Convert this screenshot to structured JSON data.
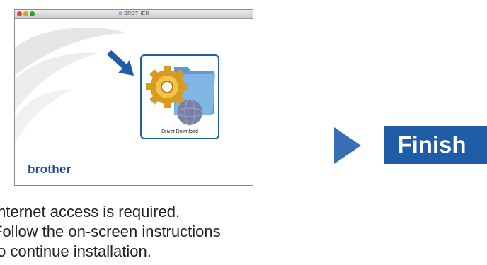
{
  "window": {
    "title": "BROTHER",
    "brand": "brother",
    "driver_button_label": "Driver Download"
  },
  "finish_label": "Finish",
  "instructions": [
    "Internet access is required.",
    "Follow the on-screen instructions",
    "to continue installation."
  ],
  "colors": {
    "brand_blue": "#1f5da8",
    "finish_bg": "#1f5da8",
    "arrow_blue": "#3a6fb5"
  },
  "icons": [
    "close-icon",
    "minimize-icon",
    "maximize-icon",
    "brother-logo-icon",
    "pointer-arrow-icon",
    "gear-folder-globe-icon",
    "play-arrow-icon"
  ]
}
